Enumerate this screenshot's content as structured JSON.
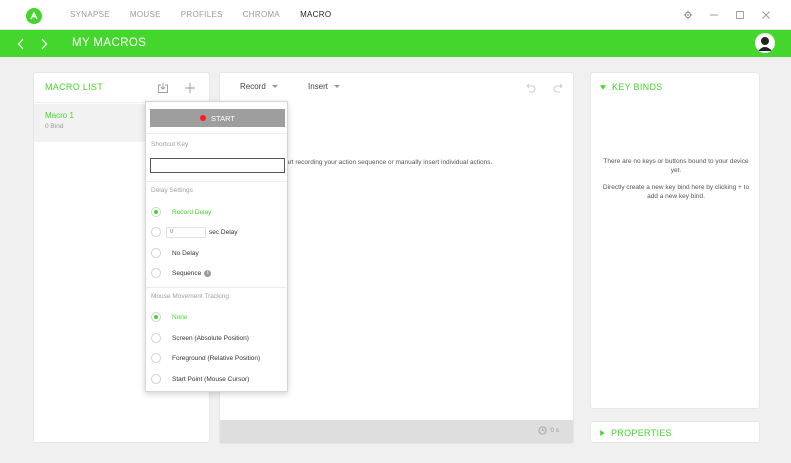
{
  "app": {
    "nav_tabs": [
      {
        "label": "SYNAPSE",
        "active": false
      },
      {
        "label": "MOUSE",
        "active": false
      },
      {
        "label": "PROFILES",
        "active": false
      },
      {
        "label": "CHROMA",
        "active": false
      },
      {
        "label": "MACRO",
        "active": true
      }
    ],
    "brand_color": "#44d62c"
  },
  "header": {
    "title": "MY MACROS"
  },
  "macro_list": {
    "title": "MACRO LIST",
    "items": [
      {
        "name": "Macro 1",
        "subtitle": "0 Bind"
      }
    ]
  },
  "editor": {
    "record_label": "Record",
    "insert_label": "Insert",
    "hint": "art recording your action sequence or manually insert individual actions.",
    "time": "0 s"
  },
  "record_popup": {
    "start_label": "START",
    "shortcut_label": "Shortcut Key",
    "shortcut_value": "",
    "delay_settings_label": "Delay Settings",
    "delay_options": {
      "record_delay": "Record Delay",
      "sec_delay_placeholder": "0",
      "sec_delay_suffix": "sec Delay",
      "no_delay": "No Delay",
      "sequence": "Sequence"
    },
    "delay_selected": "record_delay",
    "mouse_tracking_label": "Mouse Movement Tracking",
    "mouse_options": {
      "none": "None",
      "screen": "Screen (Absolute Position)",
      "foreground": "Foreground (Relative Position)",
      "start_point": "Start Point (Mouse Cursor)"
    },
    "mouse_selected": "none"
  },
  "key_binds": {
    "title": "KEY BINDS",
    "empty_text": "There are no keys or buttons bound to your device yet.",
    "help_text": "Directly create a new key bind here by clicking + to add a new key bind."
  },
  "properties": {
    "title": "PROPERTIES"
  }
}
